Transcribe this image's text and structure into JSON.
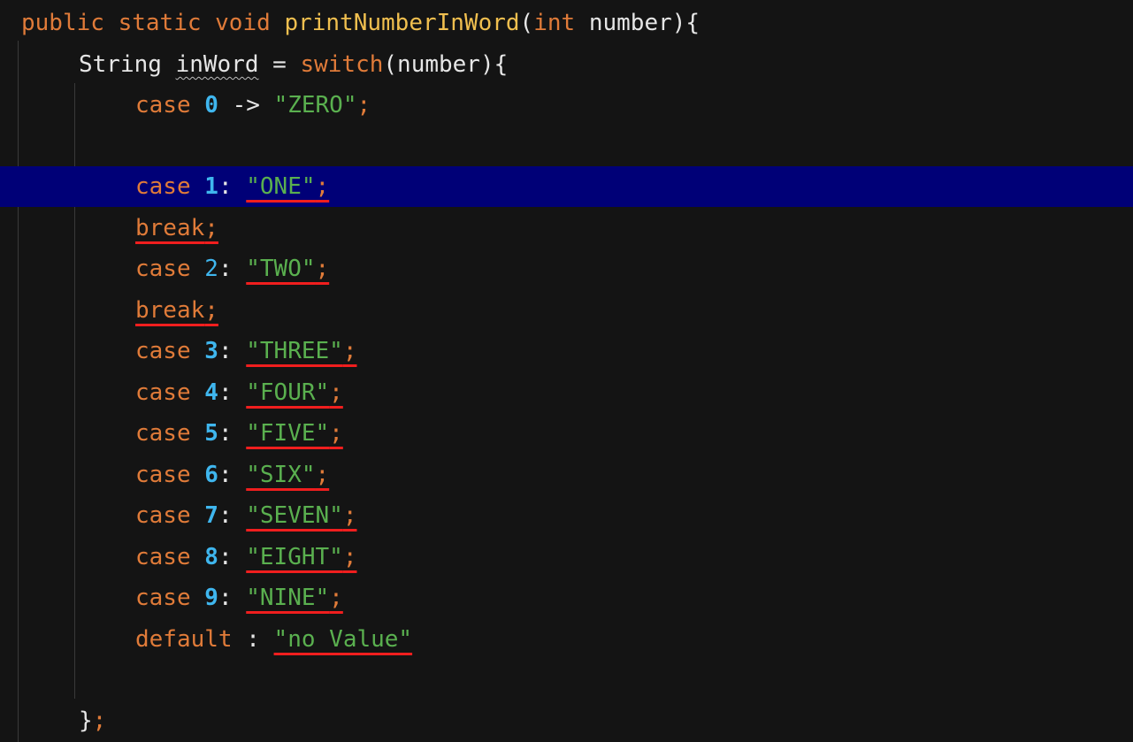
{
  "code": {
    "l1": {
      "kw_public": "public",
      "kw_static": "static",
      "kw_void": "void",
      "method": "printNumberInWord",
      "paren_open": "(",
      "kw_int": "int",
      "param": "number",
      "paren_close": "){"
    },
    "l2": {
      "type": "String",
      "var": "inWord",
      "eq": "=",
      "kw_switch": "switch",
      "args": "(number){"
    },
    "l3": {
      "kw": "case",
      "num": "0",
      "arrow": "->",
      "str": "\"ZERO\"",
      "semi": ";"
    },
    "cases": [
      {
        "kw": "case",
        "num": "1",
        "colon": ":",
        "str": "\"ONE\"",
        "semi": ";"
      },
      {
        "kw": "case",
        "num": "2",
        "colon": ":",
        "str": "\"TWO\"",
        "semi": ";"
      },
      {
        "kw": "case",
        "num": "3",
        "colon": ":",
        "str": "\"THREE\"",
        "semi": ";"
      },
      {
        "kw": "case",
        "num": "4",
        "colon": ":",
        "str": "\"FOUR\"",
        "semi": ";"
      },
      {
        "kw": "case",
        "num": "5",
        "colon": ":",
        "str": "\"FIVE\"",
        "semi": ";"
      },
      {
        "kw": "case",
        "num": "6",
        "colon": ":",
        "str": "\"SIX\"",
        "semi": ";"
      },
      {
        "kw": "case",
        "num": "7",
        "colon": ":",
        "str": "\"SEVEN\"",
        "semi": ";"
      },
      {
        "kw": "case",
        "num": "8",
        "colon": ":",
        "str": "\"EIGHT\"",
        "semi": ";"
      },
      {
        "kw": "case",
        "num": "9",
        "colon": ":",
        "str": "\"NINE\"",
        "semi": ";"
      }
    ],
    "break_stmt": {
      "kw": "break",
      "semi": ";"
    },
    "default_stmt": {
      "kw": "default",
      "colon": ":",
      "str": "\"no Value\""
    },
    "closing": {
      "brace": "}",
      "semi": ";"
    }
  },
  "colors": {
    "background": "#141414",
    "keyword": "#e07b39",
    "method": "#f0bf4f",
    "number": "#3fb6ee",
    "string": "#5ab04f",
    "error_underline": "#f01e1e",
    "caret_line": "#000077"
  }
}
